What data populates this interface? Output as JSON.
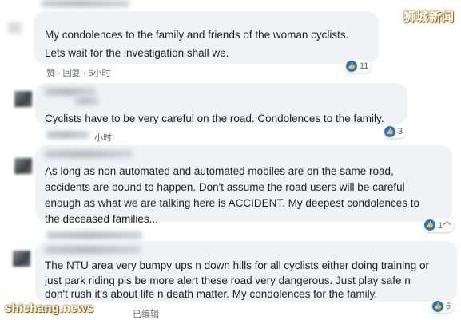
{
  "header": {
    "logo_text": "狮城新闻"
  },
  "watermark": {
    "text": "shichang.news"
  },
  "colors": {
    "bubble": "#f0f2f5",
    "like_blue": "#1b74e4",
    "meta_gray": "#65676b"
  },
  "comments": [
    {
      "lines": [
        "My condolences to the family and friends of the woman cyclists.",
        "Lets wait for the investigation shall we."
      ],
      "meta": {
        "like": "赞",
        "reply": "回复",
        "time": "6小时"
      },
      "reactions": {
        "icon": "like-icon",
        "count": "11"
      }
    },
    {
      "lines": [
        "Cyclists have to be very careful on the road. Condolences to the family."
      ],
      "meta": {
        "time": "小时"
      },
      "reactions": {
        "icon": "like-icon",
        "count": "3"
      }
    },
    {
      "lines": [
        "As long as non automated and automated mobiles are on the same road,",
        "accidents are bound to happen. Don't assume the road users will be careful",
        "enough as what we are talking here is ACCIDENT. My deepest condolences to",
        "the deceased families..."
      ],
      "reactions": {
        "icon": "like-icon",
        "count": "1个"
      }
    },
    {
      "lines": [
        "The NTU area very bumpy ups n down hills for all cyclists either doing training or",
        "just park riding pls be more alert these road very dangerous. Just play safe n",
        "don't rush it's about life n death matter. My condolences for the family."
      ],
      "meta": {
        "edited": "已编辑"
      },
      "reactions": {
        "icon": "like-icon",
        "count": "6"
      }
    }
  ]
}
